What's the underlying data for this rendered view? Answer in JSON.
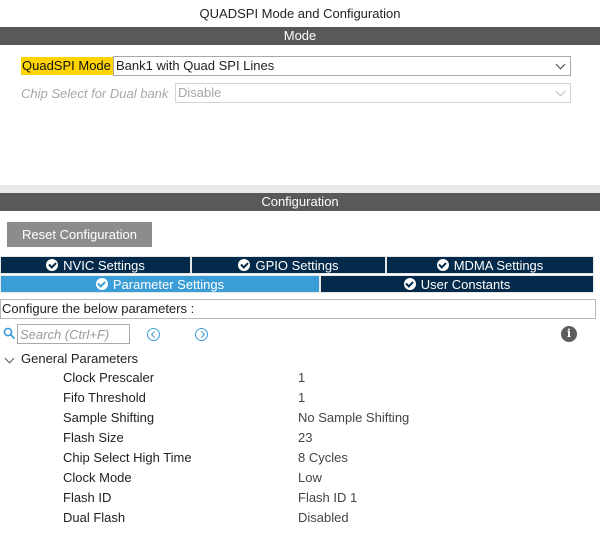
{
  "window": {
    "title": "QUADSPI Mode and Configuration"
  },
  "mode_section": {
    "header": "Mode",
    "quadspi_mode": {
      "label": "QuadSPI Mode",
      "value": "Bank1 with Quad SPI Lines"
    },
    "chip_select": {
      "label": "Chip Select for Dual bank",
      "value": "Disable"
    }
  },
  "config_section": {
    "header": "Configuration",
    "reset_label": "Reset Configuration",
    "tabs": [
      {
        "label": "NVIC Settings"
      },
      {
        "label": "GPIO Settings"
      },
      {
        "label": "MDMA Settings"
      },
      {
        "label": "Parameter Settings"
      },
      {
        "label": "User Constants"
      }
    ],
    "configure_text": "Configure the below parameters :",
    "search": {
      "placeholder": "Search (Ctrl+F)"
    },
    "group_title": "General Parameters",
    "parameters": [
      {
        "name": "Clock Prescaler",
        "value": "1"
      },
      {
        "name": "Fifo Threshold",
        "value": "1"
      },
      {
        "name": "Sample Shifting",
        "value": "No Sample Shifting"
      },
      {
        "name": "Flash Size",
        "value": "23"
      },
      {
        "name": "Chip Select High Time",
        "value": "8 Cycles"
      },
      {
        "name": "Clock Mode",
        "value": "Low"
      },
      {
        "name": "Flash ID",
        "value": "Flash ID 1"
      },
      {
        "name": "Dual Flash",
        "value": "Disabled"
      }
    ]
  },
  "colors": {
    "section_bar": "#595959",
    "highlight": "#ffd400",
    "tab_dark": "#032a4b",
    "tab_active": "#3b9dd6",
    "button": "#8c8c8c"
  },
  "icons": [
    "check-circle-icon",
    "search-icon",
    "chevron-left-icon",
    "chevron-right-icon",
    "info-icon",
    "chevron-down-icon"
  ]
}
